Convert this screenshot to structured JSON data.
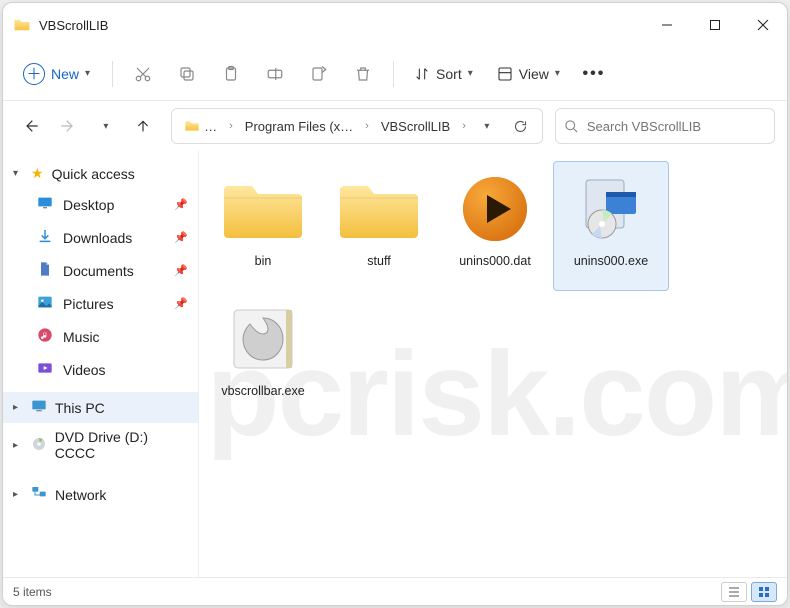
{
  "window": {
    "title": "VBScrollLIB"
  },
  "toolbar": {
    "new_label": "New",
    "sort_label": "Sort",
    "view_label": "View"
  },
  "breadcrumbs": {
    "first": "…",
    "second": "Program Files (x…",
    "third": "VBScrollLIB"
  },
  "search": {
    "placeholder": "Search VBScrollLIB"
  },
  "sidebar": {
    "quick": "Quick access",
    "items": [
      {
        "label": "Desktop"
      },
      {
        "label": "Downloads"
      },
      {
        "label": "Documents"
      },
      {
        "label": "Pictures"
      },
      {
        "label": "Music"
      },
      {
        "label": "Videos"
      }
    ],
    "this_pc": "This PC",
    "dvd": "DVD Drive (D:) CCCC",
    "network": "Network"
  },
  "files": [
    {
      "label": "bin"
    },
    {
      "label": "stuff"
    },
    {
      "label": "unins000.dat"
    },
    {
      "label": "unins000.exe"
    },
    {
      "label": "vbscrollbar.exe"
    }
  ],
  "status": {
    "count": "5 items"
  }
}
